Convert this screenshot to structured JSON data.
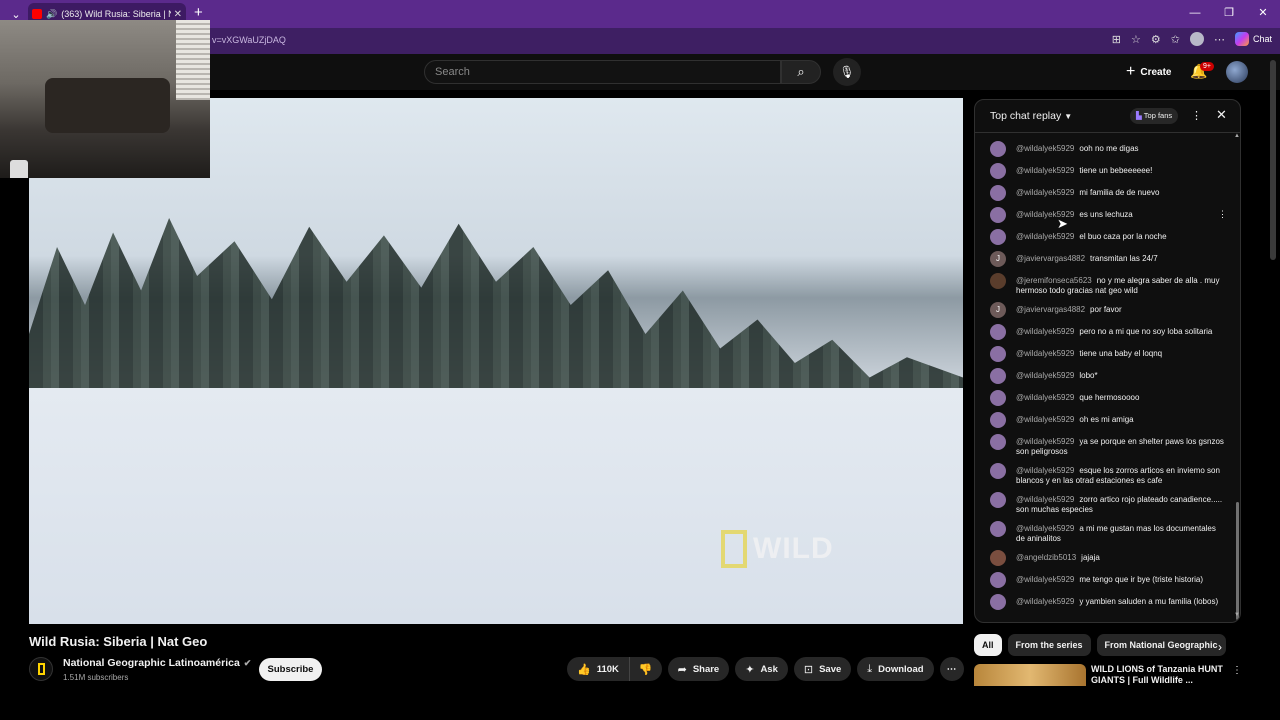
{
  "browser": {
    "tab_title": "(363) Wild Rusia: Siberia | Nat",
    "url": "v=vXGWaUZjDAQ",
    "copilot_label": "Chat"
  },
  "yt": {
    "search_placeholder": "Search",
    "create_label": "Create",
    "notif_badge": "9+"
  },
  "video": {
    "watermark": "WILD",
    "title": "Wild Rusia: Siberia | Nat Geo",
    "channel": "National Geographic Latinoamérica",
    "subscribers": "1.51M subscribers",
    "subscribe_label": "Subscribe",
    "actions": {
      "likes": "110K",
      "share": "Share",
      "ask": "Ask",
      "save": "Save",
      "download": "Download"
    }
  },
  "chat": {
    "title": "Top chat replay",
    "top_fans": "Top fans",
    "messages": [
      {
        "initial": "",
        "author": "@wildalyek5929",
        "text": "ooh no me digas"
      },
      {
        "initial": "",
        "author": "@wildalyek5929",
        "text": "tiene un bebeeeeee!"
      },
      {
        "initial": "",
        "author": "@wildalyek5929",
        "text": "mi familia de de nuevo"
      },
      {
        "initial": "",
        "author": "@wildalyek5929",
        "text": "es uns lechuza"
      },
      {
        "initial": "",
        "author": "@wildalyek5929",
        "text": "el buo caza por la noche"
      },
      {
        "initial": "J",
        "author": "@javiervargas4882",
        "text": "transmitan las 24/7"
      },
      {
        "initial": "",
        "author": "@jeremifonseca5623",
        "text": "no y me alegra saber de alla . muy hermoso todo gracias nat geo wild"
      },
      {
        "initial": "J",
        "author": "@javiervargas4882",
        "text": "por favor"
      },
      {
        "initial": "",
        "author": "@wildalyek5929",
        "text": "pero no a mi que no soy loba solitaria"
      },
      {
        "initial": "",
        "author": "@wildalyek5929",
        "text": "tiene una baby el loqnq"
      },
      {
        "initial": "",
        "author": "@wildalyek5929",
        "text": "lobo*"
      },
      {
        "initial": "",
        "author": "@wildalyek5929",
        "text": "que hermosoooo"
      },
      {
        "initial": "",
        "author": "@wildalyek5929",
        "text": "oh es mi amiga"
      },
      {
        "initial": "",
        "author": "@wildalyek5929",
        "text": "ya se porque en shelter paws los gsnzos son peligrosos"
      },
      {
        "initial": "",
        "author": "@wildalyek5929",
        "text": "esque los zorros articos en inviemo son blancos y en las otrad estaciones es cafe"
      },
      {
        "initial": "",
        "author": "@wildalyek5929",
        "text": "zorro artico rojo plateado canadience..... son muchas especies"
      },
      {
        "initial": "",
        "author": "@wildalyek5929",
        "text": "a mi me gustan mas los documentales de aninalitos"
      },
      {
        "initial": "",
        "author": "@angeldzib5013",
        "text": "jajaja"
      },
      {
        "initial": "",
        "author": "@wildalyek5929",
        "text": "me tengo que ir bye (triste historia)"
      },
      {
        "initial": "",
        "author": "@wildalyek5929",
        "text": "y yambien saluden a mu familia (lobos)"
      }
    ]
  },
  "chips": [
    "All",
    "From the series",
    "From National Geographic"
  ],
  "recommendation": {
    "title": "WILD LIONS of Tanzania HUNT GIANTS | Full Wildlife ..."
  }
}
